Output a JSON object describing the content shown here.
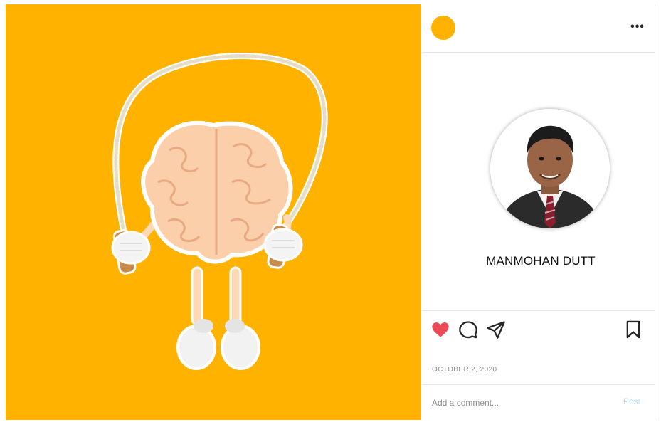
{
  "post": {
    "image_description_icon": "brain-jump-rope-illustration",
    "background_color": "#ffb300"
  },
  "header": {
    "avatar_color": "#ffb300",
    "more_icon": "more-horizontal-icon",
    "more_label": "•••"
  },
  "author": {
    "name": "MANMOHAN DUTT"
  },
  "actions": {
    "like_icon": "heart-filled-icon",
    "like_color": "#ed4956",
    "comment_icon": "comment-icon",
    "share_icon": "paper-plane-icon",
    "save_icon": "bookmark-icon"
  },
  "meta": {
    "date": "OCTOBER 2, 2020"
  },
  "comment": {
    "placeholder": "Add a comment...",
    "post_label": "Post"
  }
}
